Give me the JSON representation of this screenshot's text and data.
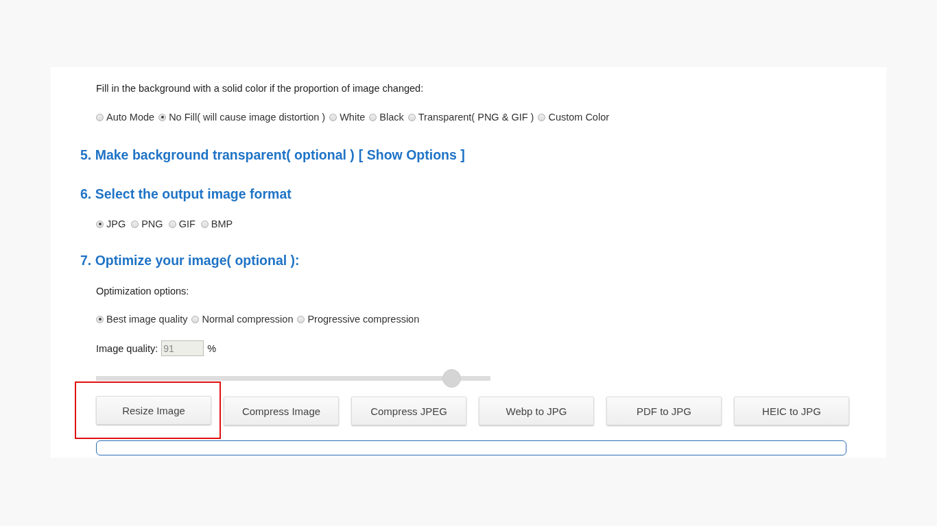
{
  "fill_background": {
    "label": "Fill in the background with a solid color if the proportion of image changed:",
    "options": [
      {
        "label": "Auto Mode",
        "selected": false
      },
      {
        "label": "No Fill( will cause image distortion )",
        "selected": true
      },
      {
        "label": "White",
        "selected": false
      },
      {
        "label": "Black",
        "selected": false
      },
      {
        "label": "Transparent( PNG & GIF )",
        "selected": false
      },
      {
        "label": "Custom Color",
        "selected": false
      }
    ]
  },
  "transparent_section": {
    "heading": "5. Make background transparent( optional )",
    "link": "[ Show Options ]"
  },
  "format_section": {
    "heading": "6. Select the output image format",
    "options": [
      {
        "label": "JPG",
        "selected": true
      },
      {
        "label": "PNG",
        "selected": false
      },
      {
        "label": "GIF",
        "selected": false
      },
      {
        "label": "BMP",
        "selected": false
      }
    ]
  },
  "optimize_section": {
    "heading": "7. Optimize your image( optional ):",
    "options_label": "Optimization options:",
    "options": [
      {
        "label": "Best image quality",
        "selected": true
      },
      {
        "label": "Normal compression",
        "selected": false
      },
      {
        "label": "Progressive compression",
        "selected": false
      }
    ],
    "quality_label": "Image quality:",
    "quality_value": "91",
    "quality_unit": "%",
    "quality_slider": {
      "level": 0.9
    }
  },
  "tool_buttons": [
    {
      "label": "Resize Image",
      "highlighted": true
    },
    {
      "label": "Compress Image",
      "highlighted": false
    },
    {
      "label": "Compress JPEG",
      "highlighted": false
    },
    {
      "label": "Webp to JPG",
      "highlighted": false
    },
    {
      "label": "PDF to JPG",
      "highlighted": false
    },
    {
      "label": "HEIC to JPG",
      "highlighted": false
    }
  ]
}
